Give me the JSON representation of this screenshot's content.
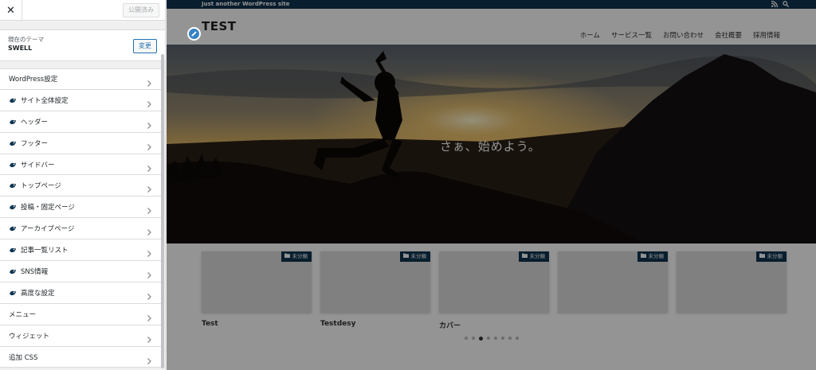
{
  "sidebar": {
    "close_label": "✕",
    "publish_label": "公開済み",
    "theme_caption": "現在のテーマ",
    "theme_name": "SWELL",
    "change_label": "変更",
    "items": [
      {
        "label": "WordPress設定",
        "icon": "none"
      },
      {
        "label": "サイト全体設定",
        "icon": "swell-icon"
      },
      {
        "label": "ヘッダー",
        "icon": "swell-icon"
      },
      {
        "label": "フッター",
        "icon": "swell-icon"
      },
      {
        "label": "サイドバー",
        "icon": "swell-icon"
      },
      {
        "label": "トップページ",
        "icon": "swell-icon"
      },
      {
        "label": "投稿・固定ページ",
        "icon": "swell-icon"
      },
      {
        "label": "アーカイブページ",
        "icon": "swell-icon"
      },
      {
        "label": "記事一覧リスト",
        "icon": "swell-icon"
      },
      {
        "label": "SNS情報",
        "icon": "swell-icon"
      },
      {
        "label": "高度な設定",
        "icon": "swell-icon"
      },
      {
        "label": "メニュー",
        "icon": "none"
      },
      {
        "label": "ウィジェット",
        "icon": "none"
      },
      {
        "label": "追加 CSS",
        "icon": "none"
      }
    ]
  },
  "preview": {
    "tagline": "Just another WordPress site",
    "site_title": "TEST",
    "nav": [
      "ホーム",
      "サービス一覧",
      "お問い合わせ",
      "会社概要",
      "採用情報"
    ],
    "hero_text": "さぁ、始めよう。",
    "posts": [
      {
        "category": "未分類",
        "title": "Test"
      },
      {
        "category": "未分類",
        "title": "Testdesy"
      },
      {
        "category": "未分類",
        "title": "カバー"
      },
      {
        "category": "未分類",
        "title": ""
      },
      {
        "category": "未分類",
        "title": ""
      }
    ],
    "slider_dots": 8,
    "active_dot": 2
  },
  "colors": {
    "accent": "#2271b1",
    "brand_dark": "#0f3550"
  }
}
